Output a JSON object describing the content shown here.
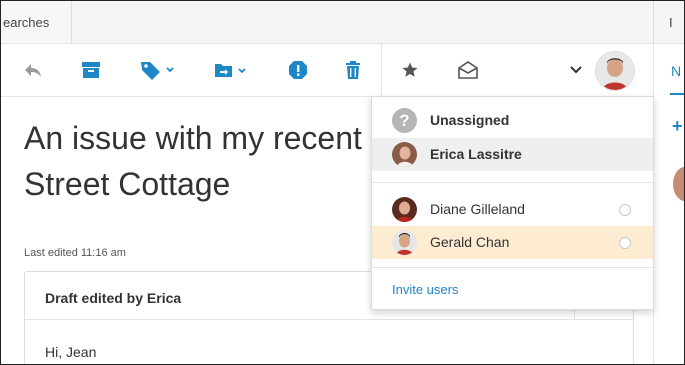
{
  "tabs": {
    "left_tab_label": "earches",
    "right_fragment": "I"
  },
  "toolbar": {
    "icons": [
      "reply-icon",
      "archive-icon",
      "tag-icon",
      "move-to-folder-icon",
      "spam-icon",
      "trash-icon",
      "star-icon",
      "mark-read-icon",
      "chevron-down-icon"
    ]
  },
  "right_panel": {
    "tab_label": "N",
    "plus_label": "+"
  },
  "message": {
    "title_line1": "An issue with my recent",
    "title_line2": "Street Cottage",
    "last_edited": "Last edited 11:16 am",
    "draft_header": "Draft edited by Erica",
    "draft_greeting": "Hi, Jean"
  },
  "assign_dropdown": {
    "unassigned_label": "Unassigned",
    "unassigned_icon_glyph": "?",
    "current_assignee": "Erica Lassitre",
    "users": [
      {
        "name": "Diane Gilleland"
      },
      {
        "name": "Gerald Chan"
      }
    ],
    "invite_label": "Invite users"
  },
  "colors": {
    "accent": "#1e88c7",
    "hover_row": "#fdecd2",
    "selected_row": "#efefef",
    "icon_blue": "#1e88c7"
  }
}
